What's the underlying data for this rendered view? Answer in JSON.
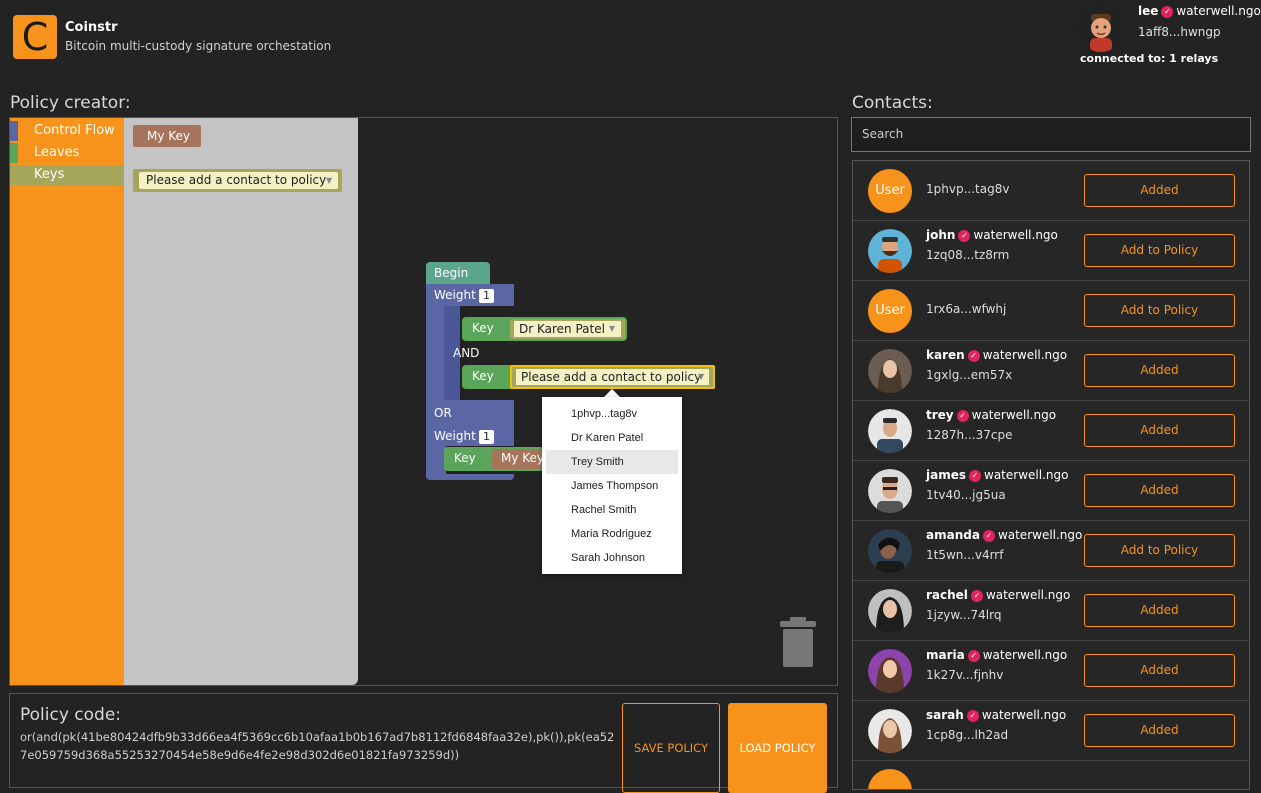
{
  "app": {
    "logo_letter": "C",
    "title": "Coinstr",
    "subtitle": "Bitcoin multi-custody signature orchestation"
  },
  "user": {
    "name": "lee",
    "domain": "waterwell.ngo",
    "npub": "1aff8...hwngp",
    "relays": "connected to: 1 relays"
  },
  "policy_creator": {
    "label": "Policy creator:",
    "categories": [
      {
        "label": "Control Flow",
        "color": "#5b67a5"
      },
      {
        "label": "Leaves",
        "color": "#5ba55b"
      },
      {
        "label": "Keys",
        "color": "#a5a55b"
      }
    ],
    "flyout": {
      "my_key": "My Key",
      "placeholder_key": "Please add a contact to policy"
    },
    "workspace": {
      "begin": "Begin",
      "weight1_label": "Weight",
      "weight1_value": "1",
      "key_label": "Key",
      "key1_value": "Dr Karen Patel",
      "and_label": "AND",
      "key2_value": "Please add a contact to policy",
      "or_label": "OR",
      "weight2_label": "Weight",
      "weight2_value": "1",
      "key3_value": "My Key"
    },
    "dropdown": [
      "1phvp...tag8v",
      "Dr Karen Patel",
      "Trey Smith",
      "James Thompson",
      "Rachel Smith",
      "Maria Rodriguez",
      "Sarah Johnson"
    ],
    "dropdown_highlight": "Trey Smith"
  },
  "policy_code": {
    "label": "Policy code:",
    "code": "or(and(pk(41be80424dfb9b33d66ea4f5369cc6b10afaa1b0b167ad7b8112fd6848faa32e),pk()),pk(ea527e059759d368a55253270454e58e9d6e4fe2e98d302d6e01821fa973259d))",
    "save_label": "SAVE POLICY",
    "load_label": "LOAD POLICY"
  },
  "contacts": {
    "label": "Contacts:",
    "search_placeholder": "Search",
    "items": [
      {
        "avatar": "User",
        "name": "",
        "domain": "",
        "npub": "1phvp...tag8v",
        "action": "Added"
      },
      {
        "avatar": "john",
        "name": "john",
        "domain": "waterwell.ngo",
        "npub": "1zq08...tz8rm",
        "action": "Add to Policy"
      },
      {
        "avatar": "User",
        "name": "",
        "domain": "",
        "npub": "1rx6a...wfwhj",
        "action": "Add to Policy"
      },
      {
        "avatar": "karen",
        "name": "karen",
        "domain": "waterwell.ngo",
        "npub": "1gxlg...em57x",
        "action": "Added"
      },
      {
        "avatar": "trey",
        "name": "trey",
        "domain": "waterwell.ngo",
        "npub": "1287h...37cpe",
        "action": "Added"
      },
      {
        "avatar": "james",
        "name": "james",
        "domain": "waterwell.ngo",
        "npub": "1tv40...jg5ua",
        "action": "Added"
      },
      {
        "avatar": "amanda",
        "name": "amanda",
        "domain": "waterwell.ngo",
        "npub": "1t5wn...v4rrf",
        "action": "Add to Policy"
      },
      {
        "avatar": "rachel",
        "name": "rachel",
        "domain": "waterwell.ngo",
        "npub": "1jzyw...74lrq",
        "action": "Added"
      },
      {
        "avatar": "maria",
        "name": "maria",
        "domain": "waterwell.ngo",
        "npub": "1k27v...fjnhv",
        "action": "Added"
      },
      {
        "avatar": "sarah",
        "name": "sarah",
        "domain": "waterwell.ngo",
        "npub": "1cp8g...lh2ad",
        "action": "Added"
      }
    ]
  },
  "colors": {
    "accent": "#f7931a",
    "control_flow": "#5b67a5",
    "leaves": "#5ba55b",
    "keys": "#a5a55b",
    "verified": "#e0245e"
  }
}
